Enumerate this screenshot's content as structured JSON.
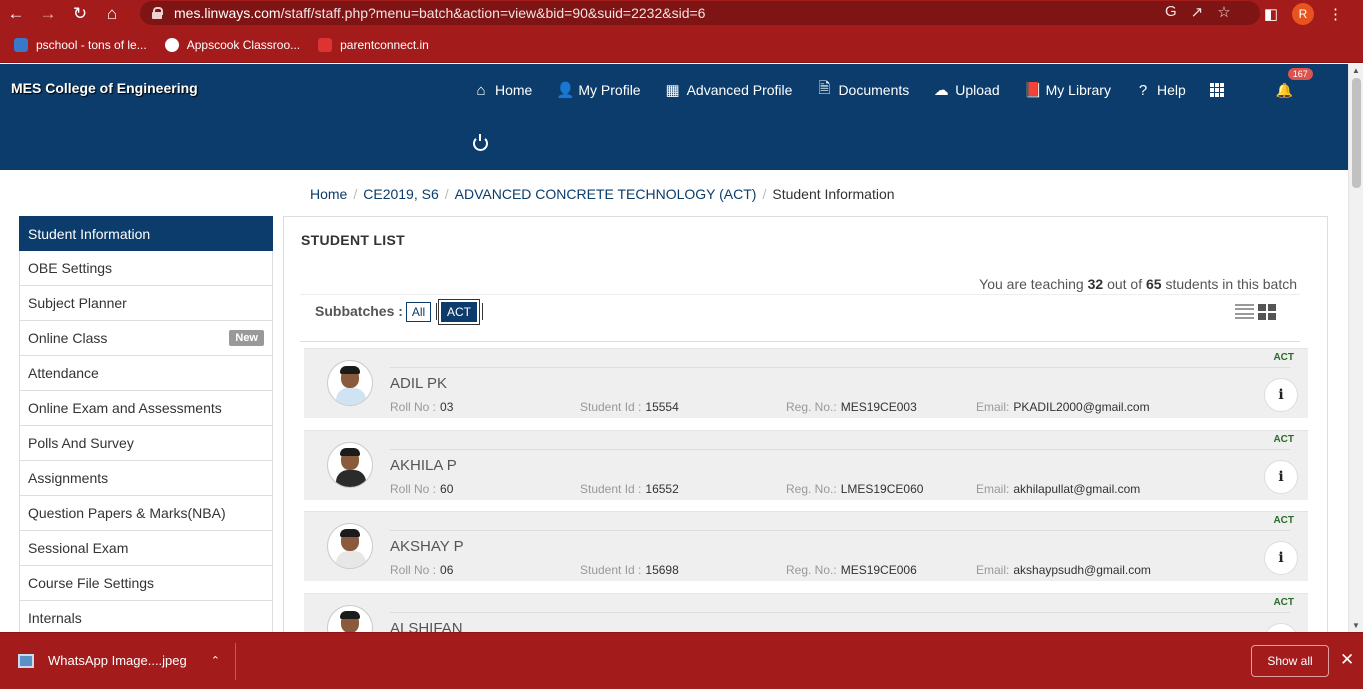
{
  "browser": {
    "url_host": "mes.linways.com",
    "url_path": "/staff/staff.php?menu=batch&action=view&bid=90&suid=2232&sid=6",
    "profile_initial": "R",
    "bookmarks": [
      {
        "label": "pschool - tons of le...",
        "color": "#3a79c9"
      },
      {
        "label": "Appscook Classroo...",
        "color": "#ffffff"
      },
      {
        "label": "parentconnect.in",
        "color": "#dd3333"
      }
    ]
  },
  "header": {
    "brand": "MES College of Engineering",
    "nav": [
      {
        "icon": "⌂",
        "label": "Home",
        "name": "home"
      },
      {
        "icon": "👤",
        "label": "My Profile",
        "name": "my-profile"
      },
      {
        "icon": "▦",
        "label": "Advanced Profile",
        "name": "advanced-profile"
      },
      {
        "icon": "🗎",
        "label": "Documents",
        "name": "documents"
      },
      {
        "icon": "☁",
        "label": "Upload",
        "name": "upload"
      },
      {
        "icon": "📕",
        "label": "My Library",
        "name": "my-library"
      },
      {
        "icon": "?",
        "label": "Help",
        "name": "help"
      }
    ],
    "notification_count": "167"
  },
  "breadcrumb": [
    {
      "label": "Home"
    },
    {
      "label": "CE2019, S6"
    },
    {
      "label": "ADVANCED CONCRETE TECHNOLOGY (ACT)"
    },
    {
      "label": "Student Information"
    }
  ],
  "sidebar": {
    "items": [
      {
        "label": "Student Information",
        "active": true
      },
      {
        "label": "OBE Settings"
      },
      {
        "label": "Subject Planner"
      },
      {
        "label": "Online Class",
        "badge": "New"
      },
      {
        "label": "Attendance"
      },
      {
        "label": "Online Exam and Assessments"
      },
      {
        "label": "Polls And Survey"
      },
      {
        "label": "Assignments"
      },
      {
        "label": "Question Papers & Marks(NBA)"
      },
      {
        "label": "Sessional Exam"
      },
      {
        "label": "Course File Settings"
      },
      {
        "label": "Internals"
      }
    ]
  },
  "panel": {
    "title": "STUDENT LIST",
    "teaching_prefix": "You are teaching ",
    "teaching_count": "32",
    "teaching_middle": " out of ",
    "teaching_total": "65",
    "teaching_suffix": " students in this batch",
    "subbatches_label": "Subbatches :",
    "subbatches": [
      "All",
      "ACT"
    ]
  },
  "students_labels": {
    "roll": "Roll No :",
    "student_id": "Student Id :",
    "reg": "Reg. No.:",
    "email": "Email:"
  },
  "students": [
    {
      "name": "ADIL PK",
      "roll": "03",
      "student_id": "15554",
      "reg": "MES19CE003",
      "email": "PKADIL2000@gmail.com",
      "tag": "ACT",
      "shirt": "#cfe3f2"
    },
    {
      "name": "AKHILA P",
      "roll": "60",
      "student_id": "16552",
      "reg": "LMES19CE060",
      "email": "akhilapullat@gmail.com",
      "tag": "ACT",
      "shirt": "#2b2b2b"
    },
    {
      "name": "AKSHAY P",
      "roll": "06",
      "student_id": "15698",
      "reg": "MES19CE006",
      "email": "akshaypsudh@gmail.com",
      "tag": "ACT",
      "shirt": "#e7e7e7"
    },
    {
      "name": "ALSHIFAN",
      "roll": "",
      "student_id": "",
      "reg": "",
      "email": "",
      "tag": "ACT",
      "shirt": "#2f7fc4"
    }
  ],
  "downloads": {
    "file": "WhatsApp Image....jpeg",
    "show_all": "Show all"
  }
}
